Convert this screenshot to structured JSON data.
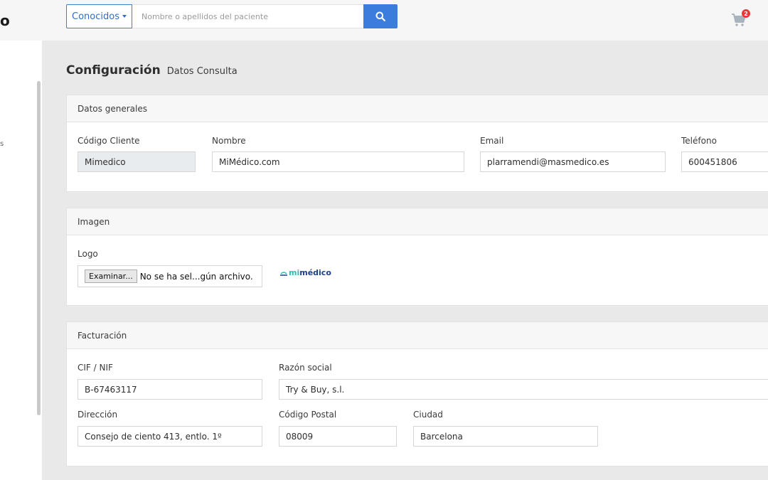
{
  "header": {
    "brand": "o",
    "dropdown_label": "Conocidos",
    "search_placeholder": "Nombre o apellidos del paciente",
    "cart_count": "2"
  },
  "sidebar": {
    "fragment": "s"
  },
  "page": {
    "title": "Configuración",
    "subtitle": "Datos Consulta"
  },
  "general": {
    "title": "Datos generales",
    "codigo_label": "Código Cliente",
    "codigo_value": "Mimedico",
    "nombre_label": "Nombre",
    "nombre_value": "MiMédico.com",
    "email_label": "Email",
    "email_value": "plarramendi@masmedico.es",
    "telefono_label": "Teléfono",
    "telefono_value": "600451806"
  },
  "imagen": {
    "title": "Imagen",
    "logo_label": "Logo",
    "browse_button": "Examinar...",
    "file_status": "No se ha sel...gún archivo.",
    "logo_text_mi": "mi",
    "logo_text_medico": "médico"
  },
  "facturacion": {
    "title": "Facturación",
    "cif_label": "CIF / NIF",
    "cif_value": "B-67463117",
    "razon_label": "Razón social",
    "razon_value": "Try & Buy, s.l.",
    "direccion_label": "Dirección",
    "direccion_value": "Consejo de ciento 413, entlo. 1º",
    "cp_label": "Código Postal",
    "cp_value": "08009",
    "ciudad_label": "Ciudad",
    "ciudad_value": "Barcelona"
  },
  "colors": {
    "accent": "#3b7ddd",
    "badge": "#e53935",
    "background": "#e9e9e9"
  }
}
